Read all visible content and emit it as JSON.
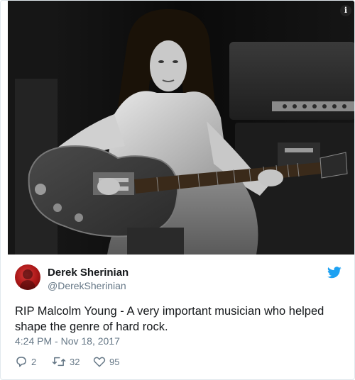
{
  "media": {
    "icons": {
      "info": "info-icon"
    }
  },
  "author": {
    "display_name": "Derek Sherinian",
    "username": "@DerekSherinian",
    "avatar_color": "#b71c1c"
  },
  "tweet": {
    "text": "RIP Malcolm Young - A very important musician who helped shape the genre of hard rock.",
    "timestamp": "4:24 PM - Nov 18, 2017"
  },
  "actions": {
    "reply_count": "2",
    "retweet_count": "32",
    "like_count": "95"
  },
  "colors": {
    "twitter_blue": "#1da1f2",
    "secondary_text": "#657786",
    "primary_text": "#14171a",
    "border": "#e1e8ed"
  }
}
